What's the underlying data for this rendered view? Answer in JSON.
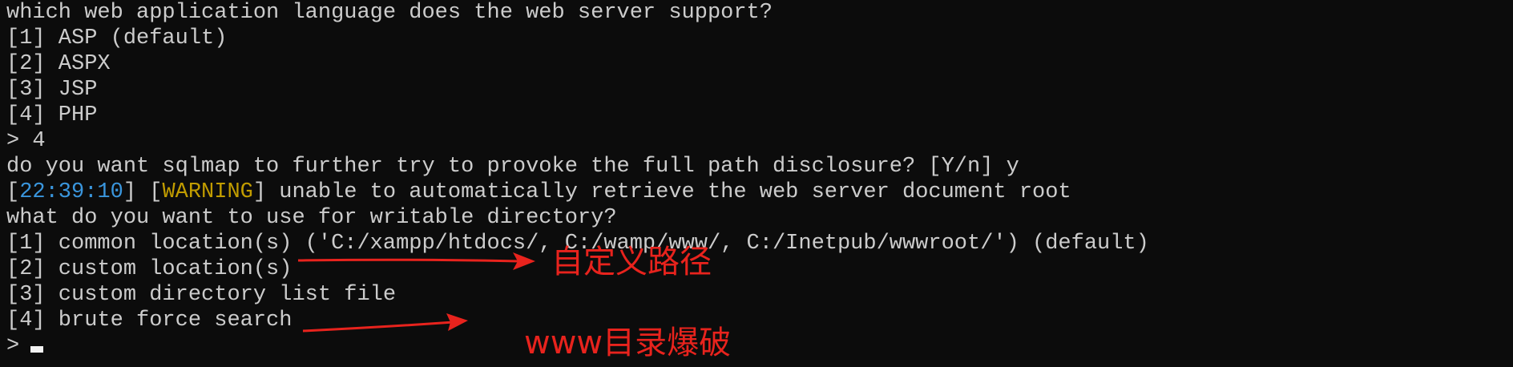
{
  "terminal": {
    "lines": [
      "which web application language does the web server support?",
      "[1] ASP (default)",
      "[2] ASPX",
      "[3] JSP",
      "[4] PHP",
      "> 4",
      "do you want sqlmap to further try to provoke the full path disclosure? [Y/n] y"
    ],
    "warning": {
      "bracket_open": "[",
      "timestamp": "22:39:10",
      "bracket_mid": "] [",
      "level": "WARNING",
      "bracket_close": "]",
      "message": " unable to automatically retrieve the web server document root"
    },
    "lines_after": [
      "what do you want to use for writable directory?",
      "[1] common location(s) ('C:/xampp/htdocs/, C:/wamp/www/, C:/Inetpub/wwwroot/') (default)",
      "[2] custom location(s)",
      "[3] custom directory list file",
      "[4] brute force search"
    ],
    "prompt": ">",
    "colors": {
      "background": "#0c0c0c",
      "text": "#cccccc",
      "timestamp": "#3a96dd",
      "warning": "#c19c00",
      "annotation": "#e8231d"
    }
  },
  "annotations": {
    "custom_path": "自定义路径",
    "www_bruteforce": "www目录爆破"
  }
}
